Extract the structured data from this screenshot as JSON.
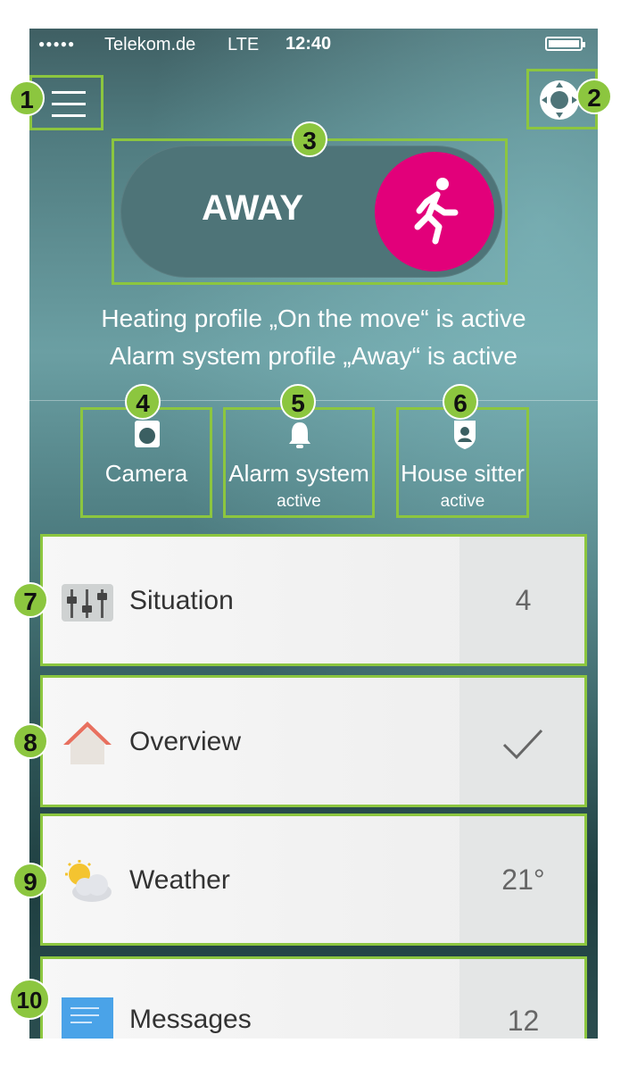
{
  "status_bar": {
    "signal": "●●●●●",
    "carrier": "Telekom.de",
    "network": "LTE",
    "time": "12:40"
  },
  "callouts": [
    "1",
    "2",
    "3",
    "4",
    "5",
    "6",
    "7",
    "8",
    "9",
    "10"
  ],
  "mode_toggle": {
    "label": "AWAY"
  },
  "status_lines": [
    "Heating profile „On the move“ is active",
    "Alarm system profile „Away“ is active"
  ],
  "quick_actions": [
    {
      "label": "Camera",
      "sub": ""
    },
    {
      "label": "Alarm system",
      "sub": "active"
    },
    {
      "label": "House sitter",
      "sub": "active"
    }
  ],
  "cards": [
    {
      "title": "Situation",
      "value": "4",
      "icon": "sliders-icon"
    },
    {
      "title": "Overview",
      "value": "",
      "icon": "house-icon",
      "checked": true
    },
    {
      "title": "Weather",
      "value": "21°",
      "icon": "partly-cloudy-icon"
    },
    {
      "title": "Messages",
      "value": "12",
      "icon": "message-icon"
    }
  ],
  "colors": {
    "accent_magenta": "#e2007a",
    "highlight_green": "#8cc63f"
  }
}
